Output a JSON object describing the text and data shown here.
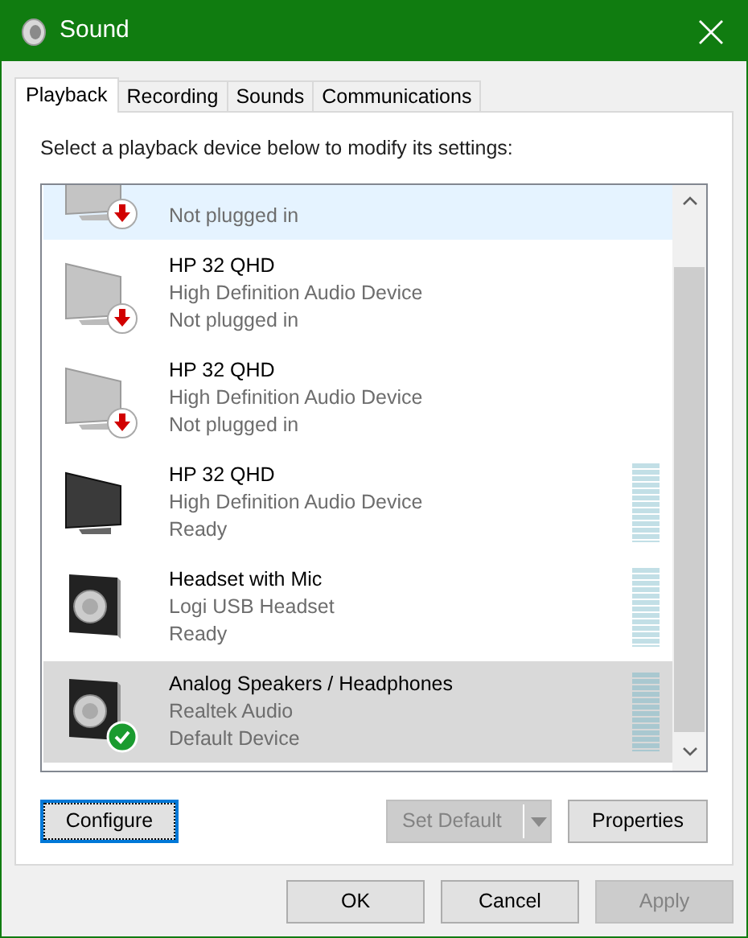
{
  "window": {
    "title": "Sound"
  },
  "tabs": [
    {
      "label": "Playback",
      "selected": true
    },
    {
      "label": "Recording",
      "selected": false
    },
    {
      "label": "Sounds",
      "selected": false
    },
    {
      "label": "Communications",
      "selected": false
    }
  ],
  "instruction": "Select a playback device below to modify its settings:",
  "devices": [
    {
      "kind": "monitor",
      "status": "Not plugged in",
      "unplugged": true,
      "default": false,
      "disabled": true,
      "selected": false,
      "hovered": true,
      "meter": false
    },
    {
      "kind": "monitor",
      "name": "HP 32 QHD",
      "description": "High Definition Audio Device",
      "status": "Not plugged in",
      "unplugged": true,
      "default": false,
      "disabled": true,
      "selected": false,
      "hovered": false,
      "meter": false
    },
    {
      "kind": "monitor",
      "name": "HP 32 QHD",
      "description": "High Definition Audio Device",
      "status": "Not plugged in",
      "unplugged": true,
      "default": false,
      "disabled": true,
      "selected": false,
      "hovered": false,
      "meter": false
    },
    {
      "kind": "monitor",
      "name": "HP 32 QHD",
      "description": "High Definition Audio Device",
      "status": "Ready",
      "unplugged": false,
      "default": false,
      "disabled": false,
      "selected": false,
      "hovered": false,
      "meter": true
    },
    {
      "kind": "speaker",
      "name": "Headset with Mic",
      "description": "Logi USB Headset",
      "status": "Ready",
      "unplugged": false,
      "default": false,
      "disabled": false,
      "selected": false,
      "hovered": false,
      "meter": true
    },
    {
      "kind": "speaker",
      "name": "Analog Speakers / Headphones",
      "description": "Realtek Audio",
      "status": "Default Device",
      "unplugged": false,
      "default": true,
      "disabled": false,
      "selected": true,
      "hovered": false,
      "meter": true
    }
  ],
  "panel_buttons": [
    {
      "label": "Configure",
      "disabled": false,
      "focused": true,
      "split": false
    },
    {
      "label": "Set Default",
      "disabled": true,
      "focused": false,
      "split": true
    },
    {
      "label": "Properties",
      "disabled": false,
      "focused": false,
      "split": false
    }
  ],
  "dialog_buttons": [
    {
      "label": "OK",
      "disabled": false
    },
    {
      "label": "Cancel",
      "disabled": false
    },
    {
      "label": "Apply",
      "disabled": true
    }
  ]
}
